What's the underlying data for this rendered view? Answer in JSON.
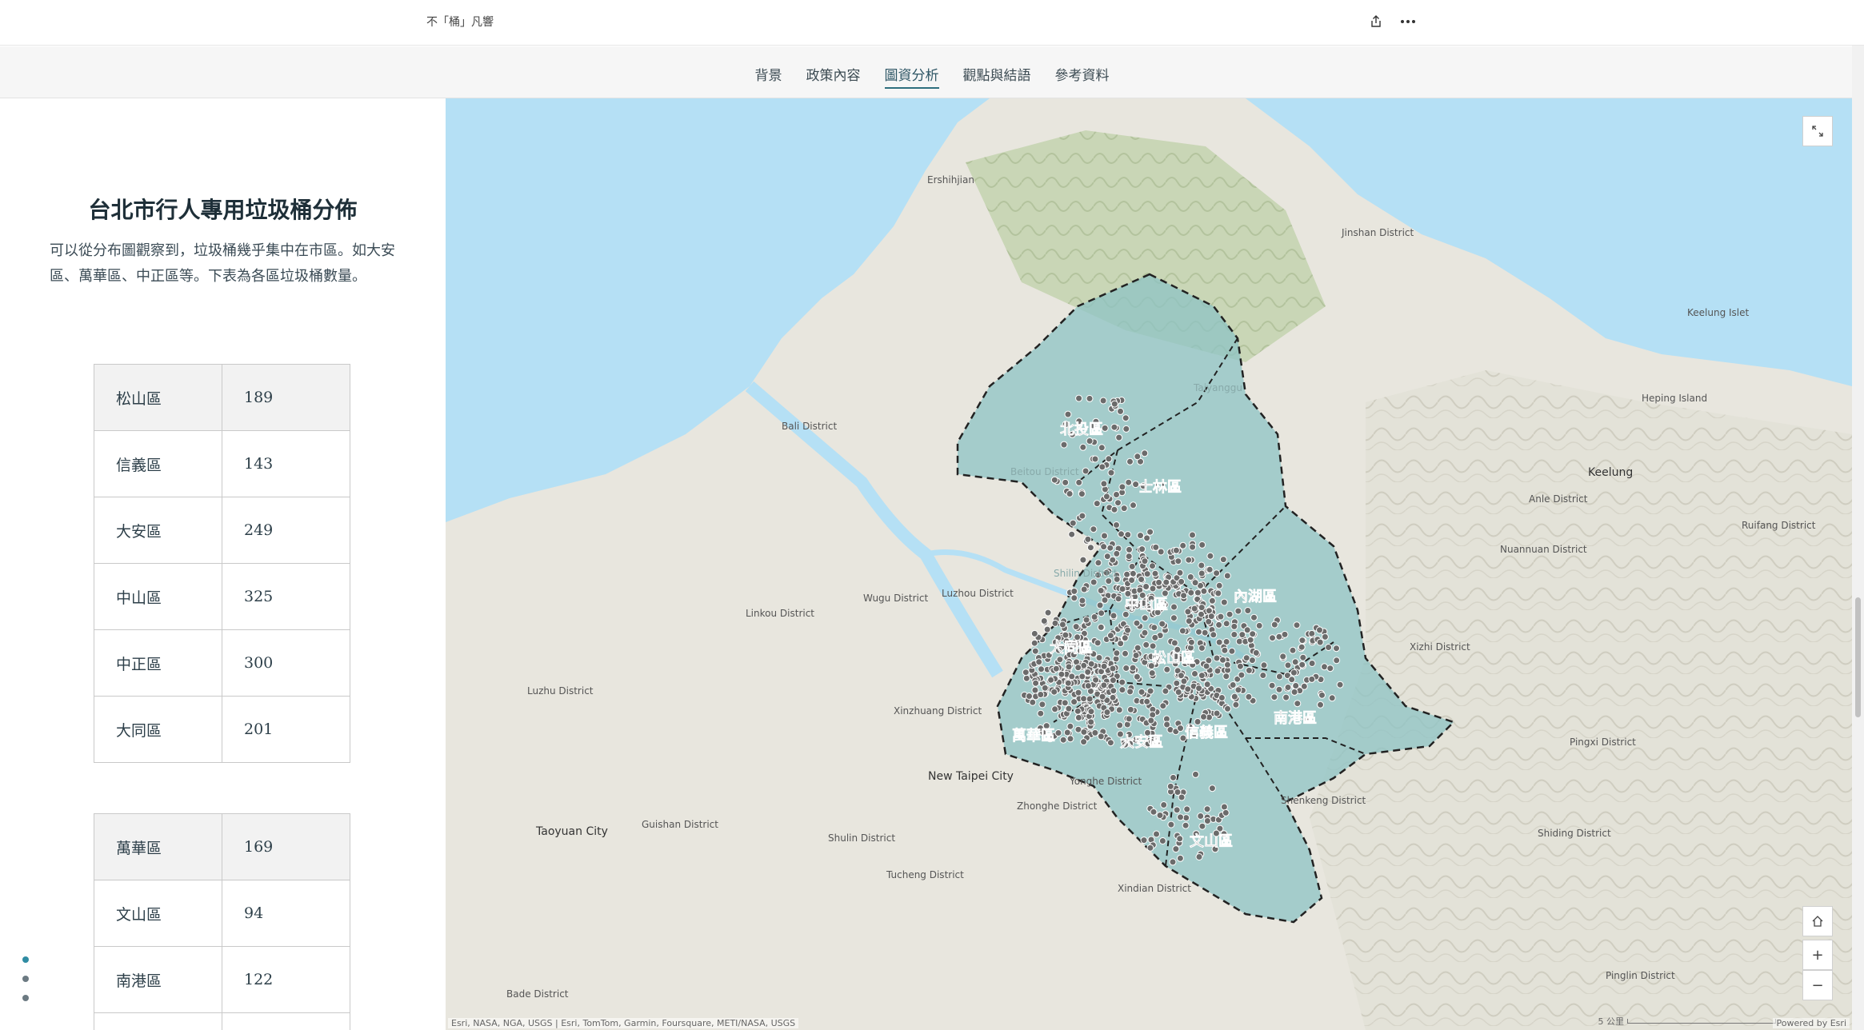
{
  "header": {
    "story_title": "不「桶」凡響",
    "share_icon": "share-icon",
    "more_icon": "more-options-icon"
  },
  "nav": {
    "items": [
      {
        "label": "背景"
      },
      {
        "label": "政策內容"
      },
      {
        "label": "圖資分析",
        "active": true
      },
      {
        "label": "觀點與結語"
      },
      {
        "label": "參考資料"
      }
    ]
  },
  "panel": {
    "title": "台北市行人專用垃圾桶分佈",
    "description": "可以從分布圖觀察到，垃圾桶幾乎集中在市區。如大安區、萬華區、中正區等。下表為各區垃圾桶數量。",
    "table1": [
      {
        "district": "松山區",
        "count": "189"
      },
      {
        "district": "信義區",
        "count": "143"
      },
      {
        "district": "大安區",
        "count": "249"
      },
      {
        "district": "中山區",
        "count": "325"
      },
      {
        "district": "中正區",
        "count": "300"
      },
      {
        "district": "大同區",
        "count": "201"
      }
    ],
    "table2": [
      {
        "district": "萬華區",
        "count": "169"
      },
      {
        "district": "文山區",
        "count": "94"
      },
      {
        "district": "南港區",
        "count": "122"
      }
    ]
  },
  "map": {
    "district_labels": [
      "北投區",
      "士林區",
      "內湖區",
      "中山區",
      "大同區",
      "松山區",
      "南港區",
      "萬華區",
      "大安區",
      "信義區",
      "文山區"
    ],
    "place_labels": [
      "Ershihjian",
      "Jinshan District",
      "Keelung Islet",
      "Heping Island",
      "Keelung",
      "Anle District",
      "Ruifang District",
      "Nuannuan District",
      "Xizhi District",
      "Pingxi District",
      "Shiding District",
      "Shenkeng District",
      "Pinglin District",
      "Bali District",
      "Wugu District",
      "Luzhou District",
      "Linkou District",
      "Luzhu District",
      "Xinzhuang District",
      "New Taipei City",
      "Taoyuan City",
      "Guishan District",
      "Shulin District",
      "Tucheng District",
      "Zhonghe District",
      "Yonghe District",
      "Xindian District",
      "Bade District",
      "Beitou District",
      "Shilin District",
      "Taiyanggu"
    ],
    "attribution": "Esri, NASA, NGA, USGS | Esri, TomTom, Garmin, Foursquare, METI/NASA, USGS",
    "powered_by": "Powered by Esri",
    "scale_label": "5 公里",
    "zoom_in": "+",
    "zoom_out": "−",
    "colors": {
      "water": "#b5e0f5",
      "land": "#e9e7df",
      "district_fill": "#8dc3c4",
      "points": "#6d6d6d",
      "boundary": "#222222"
    }
  }
}
